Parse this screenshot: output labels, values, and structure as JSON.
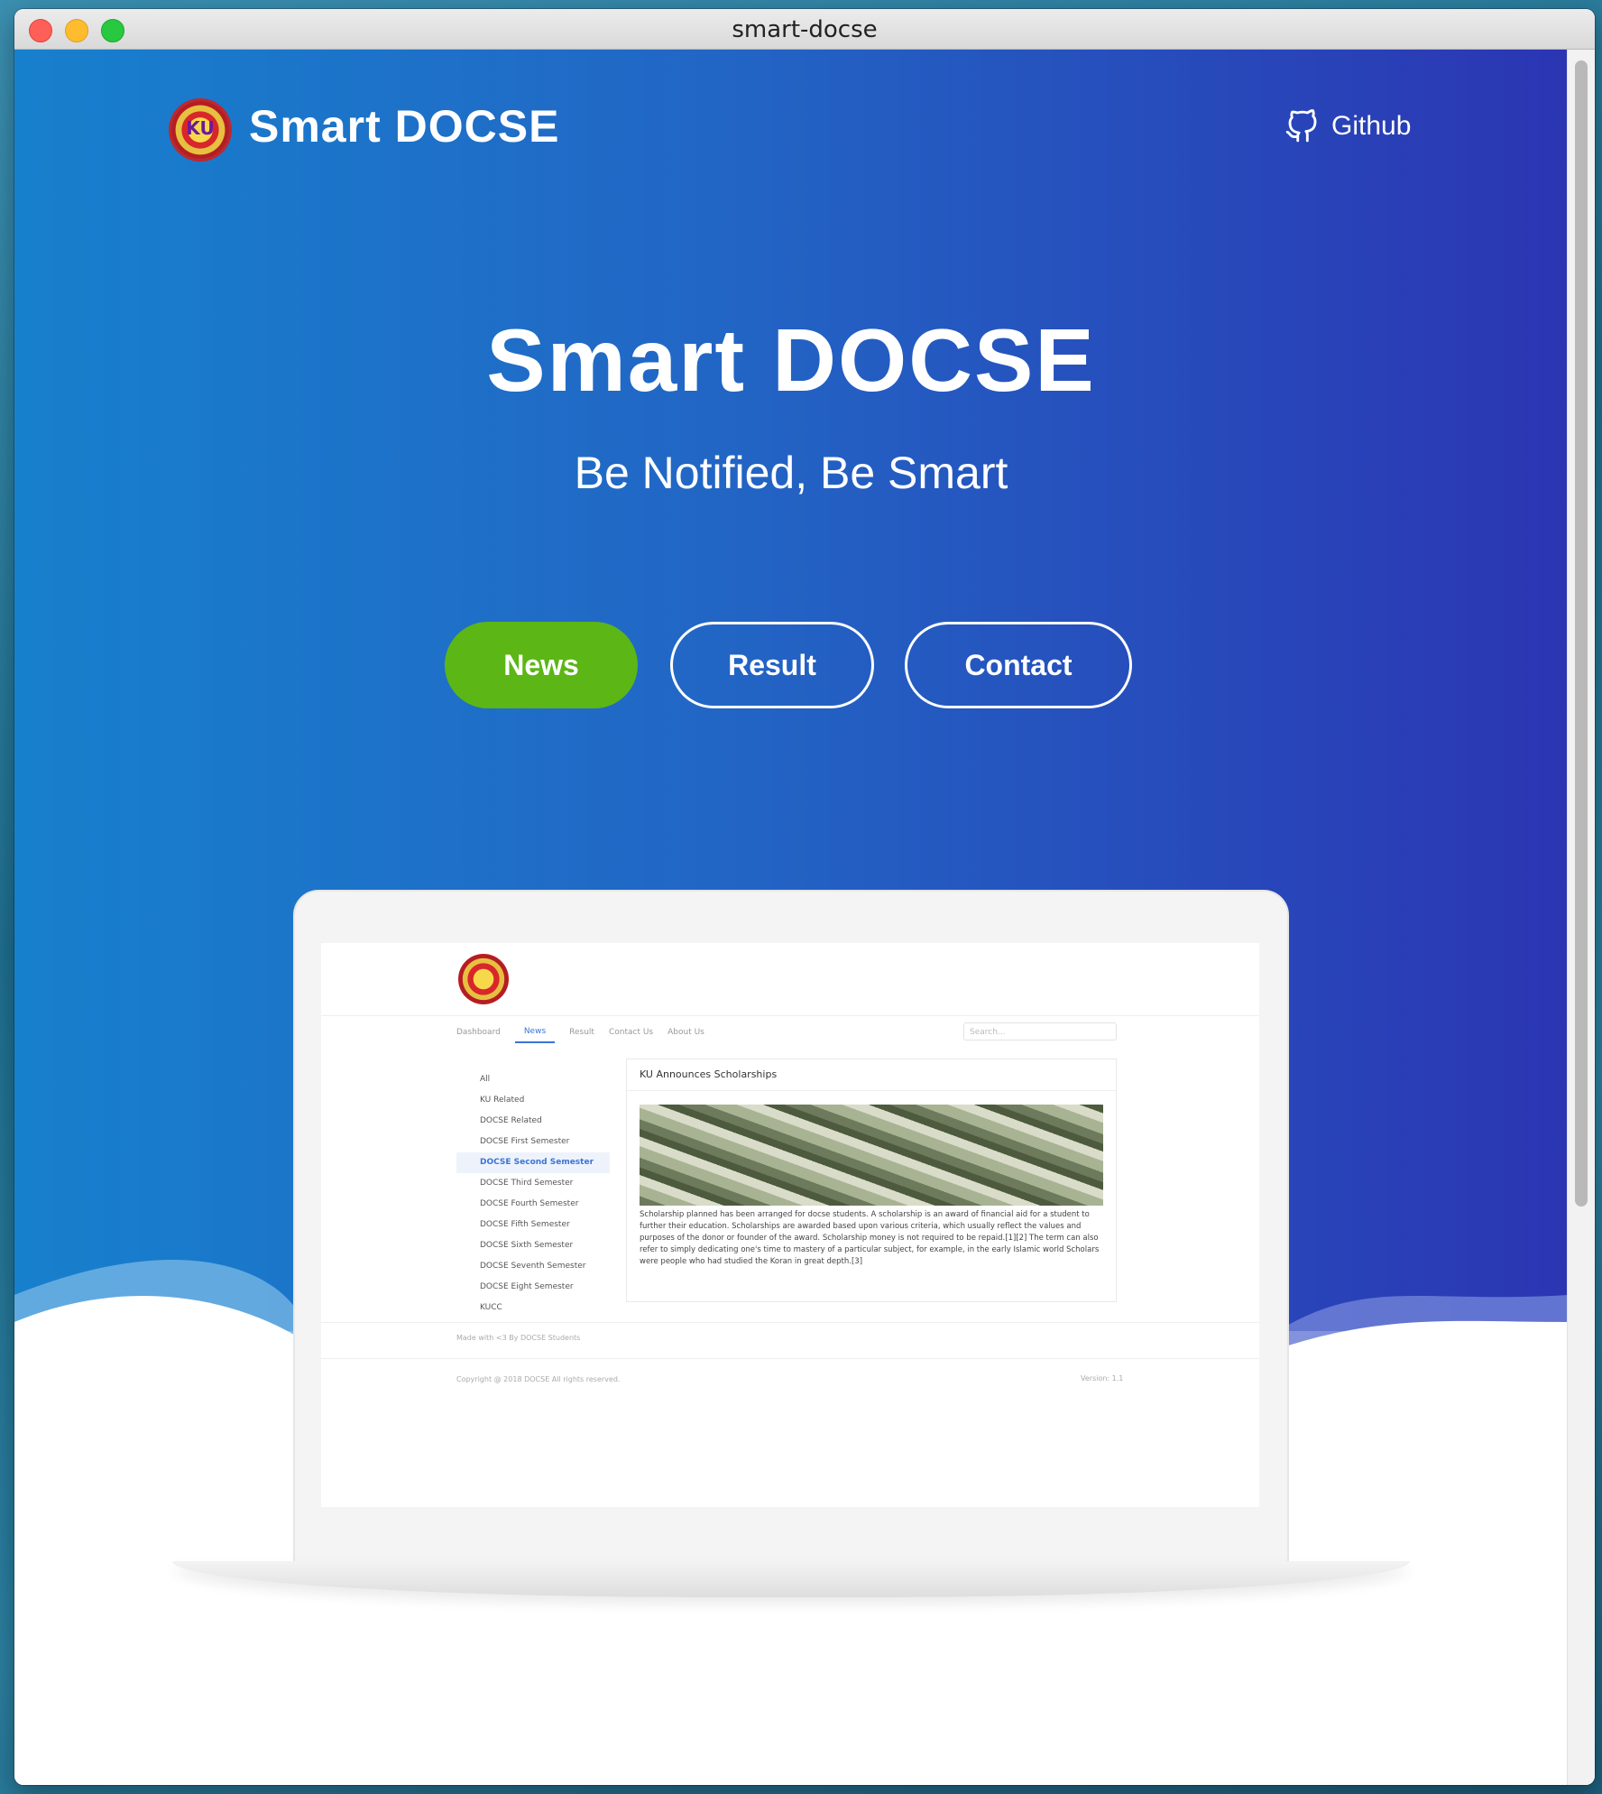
{
  "window": {
    "title": "smart-docse"
  },
  "nav": {
    "brand": "Smart DOCSE",
    "github_label": "Github"
  },
  "hero": {
    "title": "Smart DOCSE",
    "tagline": "Be Notified, Be Smart",
    "buttons": [
      {
        "label": "News",
        "color": "#5cb616"
      },
      {
        "label": "Result"
      },
      {
        "label": "Contact"
      }
    ]
  },
  "preview": {
    "logo_text": "KU",
    "nav": [
      "Dashboard",
      "News",
      "Result",
      "Contact Us",
      "About Us"
    ],
    "search_placeholder": "Search...",
    "sidebar": [
      "All",
      "KU Related",
      "DOCSE Related",
      "DOCSE First Semester",
      "DOCSE Second Semester",
      "DOCSE Third Semester",
      "DOCSE Fourth Semester",
      "DOCSE Fifth Semester",
      "DOCSE Sixth Semester",
      "DOCSE Seventh Semester",
      "DOCSE Eight Semester",
      "KUCC"
    ],
    "selected_sidebar": "DOCSE Second Semester",
    "article_title": "KU Announces Scholarships",
    "article_text": "Scholarship planned has been arranged for docse students. A scholarship is an award of financial aid for a student to further their education. Scholarships are awarded based upon various criteria, which usually reflect the values and purposes of the donor or founder of the award. Scholarship money is not required to be repaid.[1][2] The term can also refer to simply dedicating one's time to mastery of a particular subject, for example, in the early Islamic world Scholars were people who had studied the Koran in great depth.[3]",
    "footer_made": "Made with <3 By DOCSE Students",
    "footer_copyright": "Copyright @ 2018 DOCSE All rights reserved.",
    "version": "Version: 1.1"
  },
  "colors": {
    "hero_start": "#1780cd",
    "hero_end": "#2b35b3",
    "accent_green": "#5cb616",
    "link_blue": "#3b74d6"
  }
}
